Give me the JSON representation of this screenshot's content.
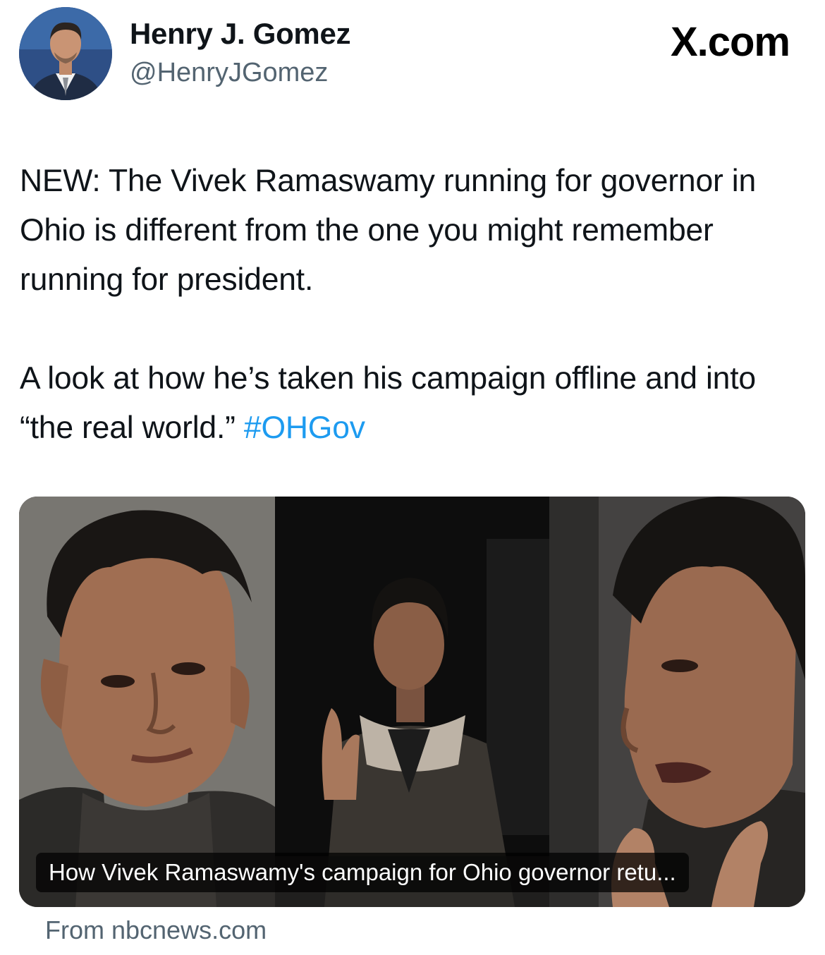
{
  "author": {
    "name": "Henry J. Gomez",
    "handle": "@HenryJGomez"
  },
  "brand": {
    "label": "X.com"
  },
  "tweet": {
    "paragraph1": "NEW: The Vivek Ramaswamy running for governor in Ohio is different from the one you might remember running for president.",
    "paragraph2_text": "A look at how he’s taken his campaign offline and into “the real world.” ",
    "hashtag": "#OHGov"
  },
  "link_card": {
    "title": "How Vivek Ramaswamy's campaign for Ohio governor retu...",
    "source": "From nbcnews.com"
  },
  "colors": {
    "hashtag": "#1d9bf0",
    "secondary_text": "#536471",
    "primary_text": "#0f1419"
  }
}
